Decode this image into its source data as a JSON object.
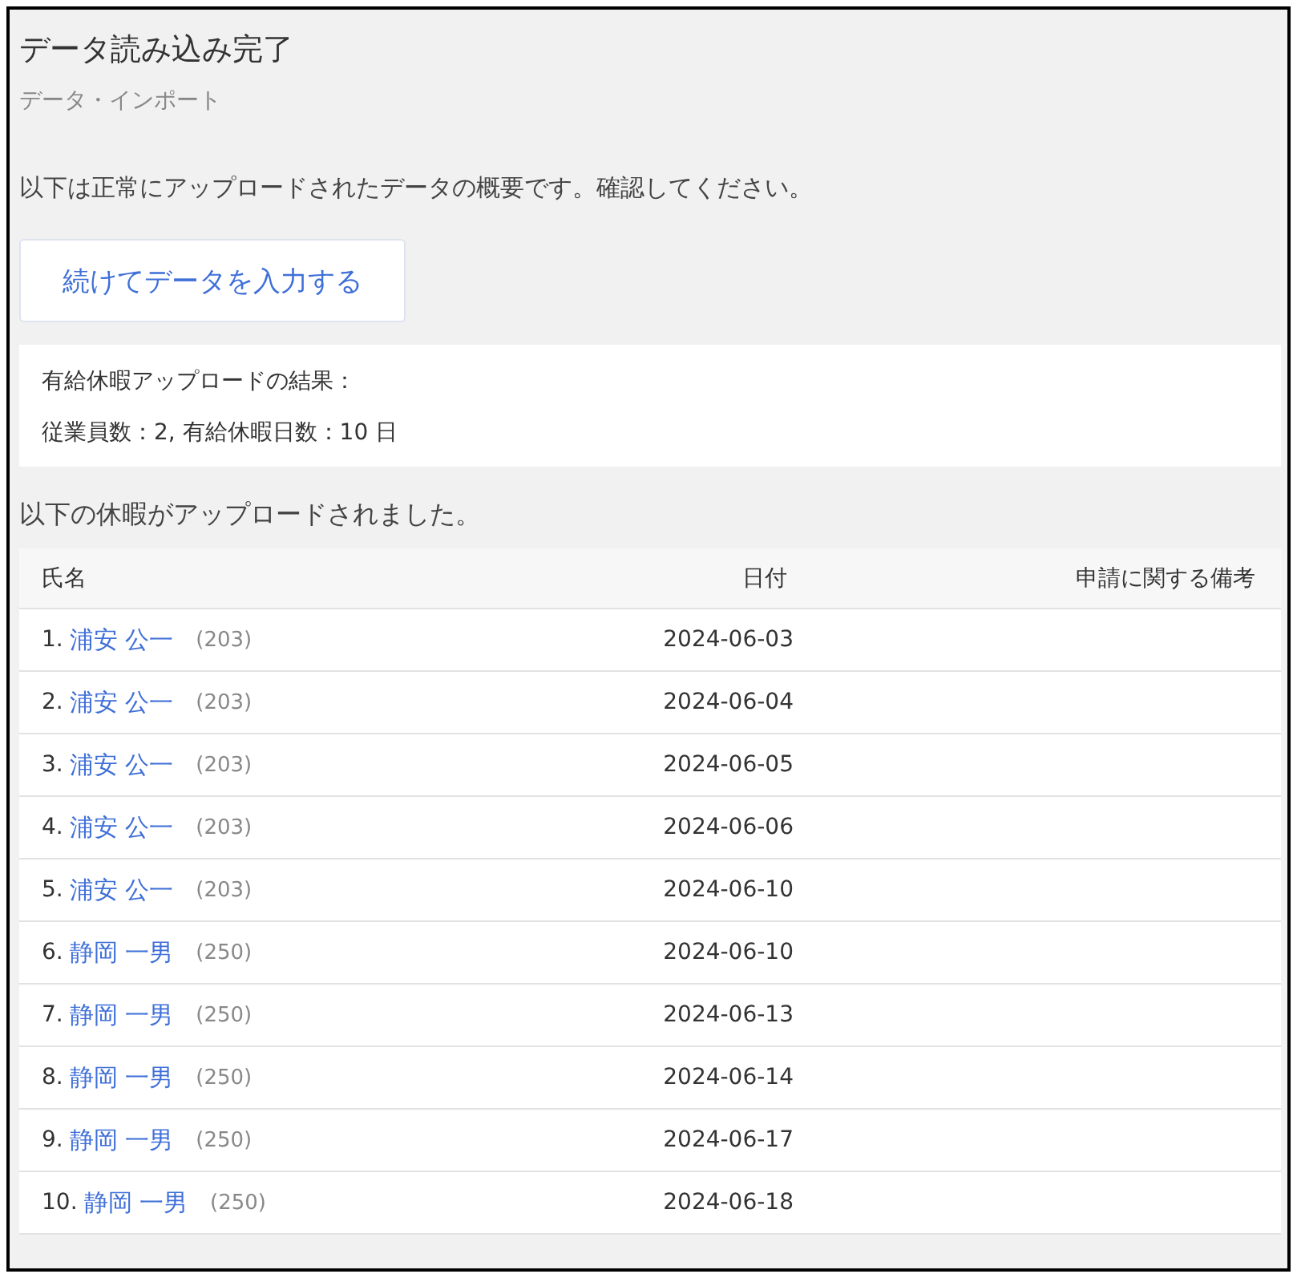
{
  "title": "データ読み込み完了",
  "subtitle": "データ・インポート",
  "description": "以下は正常にアップロードされたデータの概要です。確認してください。",
  "continue_button": "続けてデータを入力する",
  "result": {
    "heading": "有給休暇アップロードの結果：",
    "summary": "従業員数：2, 有給休暇日数：10 日"
  },
  "list_heading": "以下の休暇がアップロードされました。",
  "table": {
    "columns": [
      "氏名",
      "日付",
      "申請に関する備考"
    ],
    "rows": [
      {
        "index": "1.",
        "name": "浦安 公一",
        "code": "(203)",
        "date": "2024-06-03"
      },
      {
        "index": "2.",
        "name": "浦安 公一",
        "code": "(203)",
        "date": "2024-06-04"
      },
      {
        "index": "3.",
        "name": "浦安 公一",
        "code": "(203)",
        "date": "2024-06-05"
      },
      {
        "index": "4.",
        "name": "浦安 公一",
        "code": "(203)",
        "date": "2024-06-06"
      },
      {
        "index": "5.",
        "name": "浦安 公一",
        "code": "(203)",
        "date": "2024-06-10"
      },
      {
        "index": "6.",
        "name": "静岡 一男",
        "code": "(250)",
        "date": "2024-06-10"
      },
      {
        "index": "7.",
        "name": "静岡 一男",
        "code": "(250)",
        "date": "2024-06-13"
      },
      {
        "index": "8.",
        "name": "静岡 一男",
        "code": "(250)",
        "date": "2024-06-14"
      },
      {
        "index": "9.",
        "name": "静岡 一男",
        "code": "(250)",
        "date": "2024-06-17"
      },
      {
        "index": "10.",
        "name": "静岡 一男",
        "code": "(250)",
        "date": "2024-06-18"
      }
    ]
  }
}
